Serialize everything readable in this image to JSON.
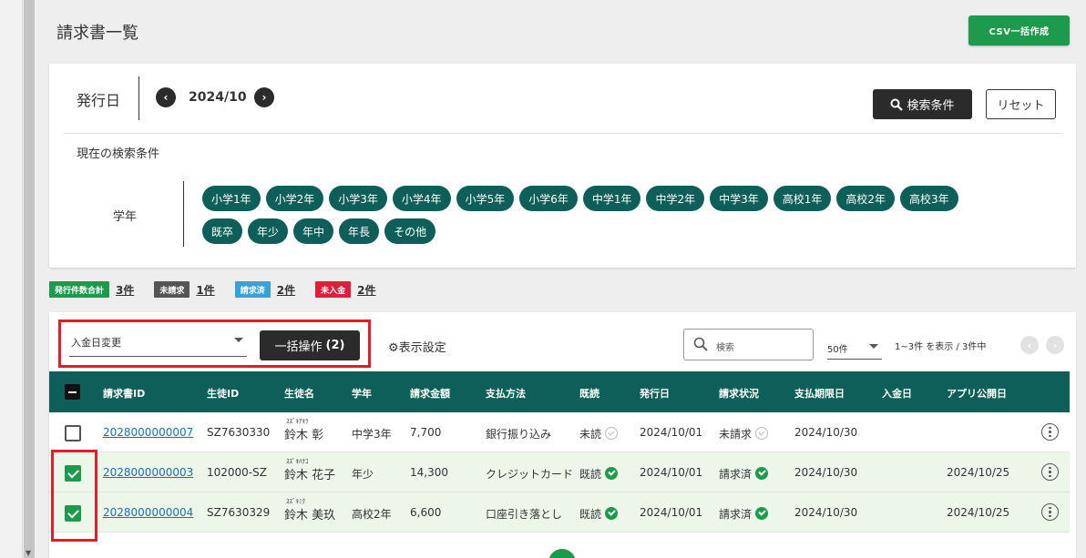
{
  "page": {
    "title": "請求書一覧",
    "csv_button": "CSV一括作成"
  },
  "search": {
    "issue_label": "発行日",
    "month": "2024/10",
    "prev_icon": "chevron-left-icon",
    "next_icon": "chevron-right-icon",
    "search_button": "検索条件",
    "reset_button": "リセット",
    "current_conditions_label": "現在の検索条件",
    "grade_label": "学年",
    "grades_row1": [
      "小学1年",
      "小学2年",
      "小学3年",
      "小学4年",
      "小学5年",
      "小学6年",
      "中学1年",
      "中学2年",
      "中学3年",
      "高校1年",
      "高校2年",
      "高校3年"
    ],
    "grades_row2": [
      "既卒",
      "年少",
      "年中",
      "年長",
      "その他"
    ]
  },
  "summary": [
    {
      "label": "発行件数合計",
      "count": "3件",
      "color": "#1e9a4d"
    },
    {
      "label": "未請求",
      "count": "1件",
      "color": "#555555"
    },
    {
      "label": "請求済",
      "count": "2件",
      "color": "#3aa0d8"
    },
    {
      "label": "未入金",
      "count": "2件",
      "color": "#e01e3c"
    }
  ],
  "toolbar": {
    "bulk_select_value": "入金日変更",
    "bulk_button": "一括操作",
    "bulk_count": "(2)",
    "display_settings": "表示設定",
    "search_placeholder": "検索",
    "per_page": "50件",
    "range_text": "1~3件 を表示 / 3件中"
  },
  "table": {
    "headers": [
      "請求書ID",
      "生徒ID",
      "生徒名",
      "学年",
      "請求金額",
      "支払方法",
      "既読",
      "発行日",
      "請求状況",
      "支払期限日",
      "入金日",
      "アプリ公開日"
    ],
    "rows": [
      {
        "checked": false,
        "invoice_id": "2028000000007",
        "student_id": "SZ7630330",
        "furigana": "ｽｽﾞｷｱｷﾗ",
        "name": "鈴木 彰",
        "grade": "中学3年",
        "amount": "7,700",
        "payment": "銀行振り込み",
        "read": "未読",
        "read_done": false,
        "issue_date": "2024/10/01",
        "status": "未請求",
        "status_done": false,
        "due_date": "2024/10/30",
        "paid_date": "",
        "app_date": ""
      },
      {
        "checked": true,
        "invoice_id": "2028000000003",
        "student_id": "102000-SZ",
        "furigana": "ｽｽﾞｷﾊﾅｺ",
        "name": "鈴木 花子",
        "grade": "年少",
        "amount": "14,300",
        "payment": "クレジットカード",
        "read": "既読",
        "read_done": true,
        "issue_date": "2024/10/01",
        "status": "請求済",
        "status_done": true,
        "due_date": "2024/10/30",
        "paid_date": "",
        "app_date": "2024/10/25"
      },
      {
        "checked": true,
        "invoice_id": "2028000000004",
        "student_id": "SZ7630329",
        "furigana": "ｽｽﾞｷﾐｸ",
        "name": "鈴木 美玖",
        "grade": "高校2年",
        "amount": "6,600",
        "payment": "口座引き落とし",
        "read": "既読",
        "read_done": true,
        "issue_date": "2024/10/01",
        "status": "請求済",
        "status_done": true,
        "due_date": "2024/10/30",
        "paid_date": "",
        "app_date": "2024/10/25"
      }
    ]
  }
}
